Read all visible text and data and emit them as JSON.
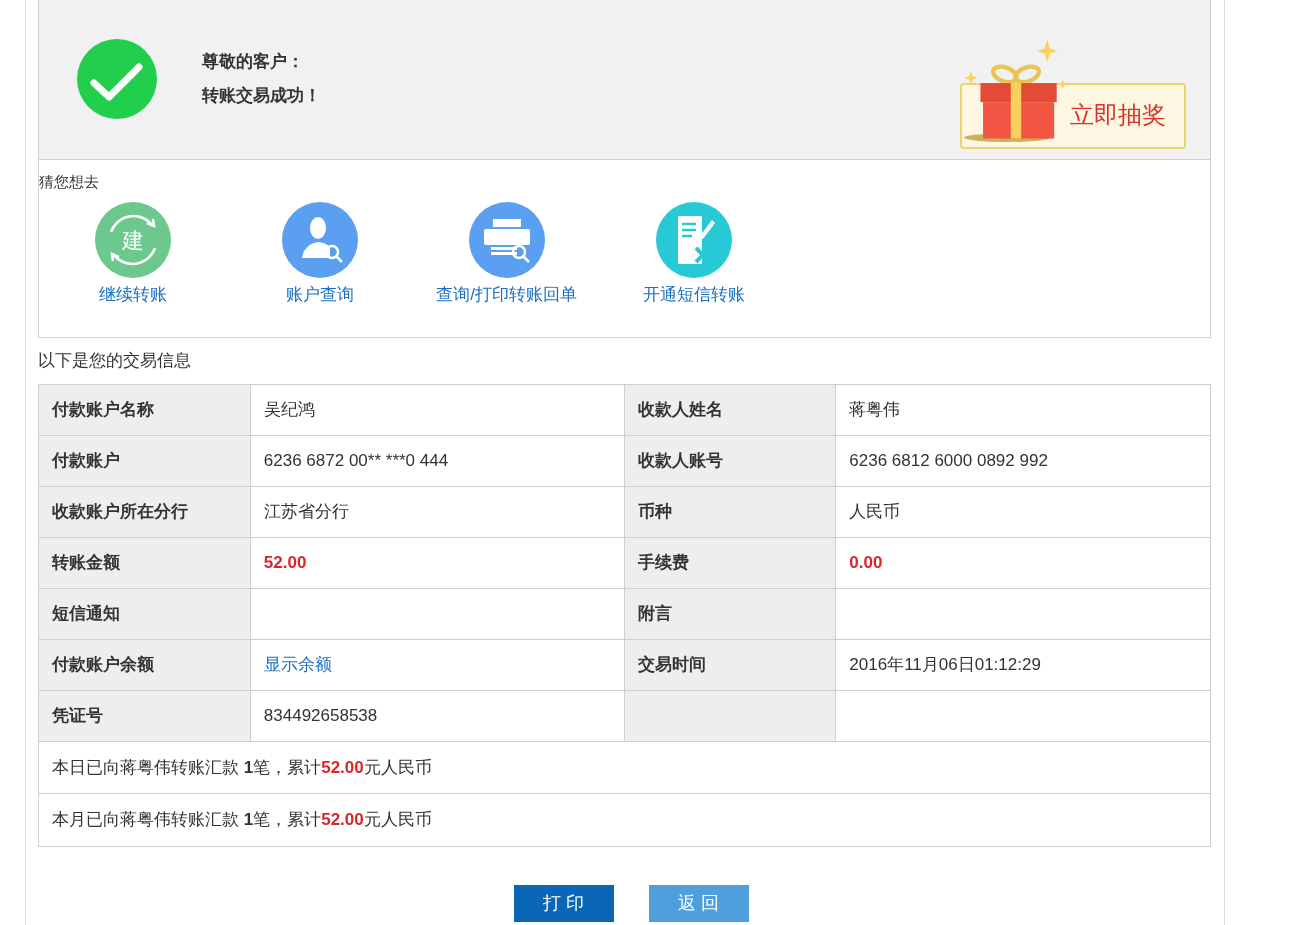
{
  "header": {
    "greeting": "尊敬的客户：",
    "message": "转账交易成功！",
    "lottery_button": "立即抽奖"
  },
  "quick_links": {
    "title": "猜您想去",
    "items": [
      {
        "kind": "transfer",
        "label": "继续转账",
        "icon_text": "建"
      },
      {
        "kind": "account",
        "label": "账户查询"
      },
      {
        "kind": "print",
        "label": "查询/打印转账回单"
      },
      {
        "kind": "sms",
        "label": "开通短信转账"
      }
    ]
  },
  "details": {
    "title": "以下是您的交易信息",
    "rows": [
      {
        "cells": [
          {
            "label": "付款账户名称",
            "value": "吴纪鸿",
            "kind": "plain"
          },
          {
            "label": "收款人姓名",
            "value": "蒋粤伟",
            "kind": "plain"
          }
        ]
      },
      {
        "cells": [
          {
            "label": "付款账户",
            "value": "6236 6872 00** ***0 444",
            "kind": "plain"
          },
          {
            "label": "收款人账号",
            "value": "6236 6812 6000 0892 992",
            "kind": "plain"
          }
        ]
      },
      {
        "cells": [
          {
            "label": "收款账户所在分行",
            "value": "江苏省分行",
            "kind": "plain"
          },
          {
            "label": "币种",
            "value": "人民币",
            "kind": "plain"
          }
        ]
      },
      {
        "cells": [
          {
            "label": "转账金额",
            "value": "52.00",
            "kind": "amount"
          },
          {
            "label": "手续费",
            "value": "0.00",
            "kind": "amount"
          }
        ]
      },
      {
        "cells": [
          {
            "label": "短信通知"
          },
          {
            "label": "附言"
          }
        ]
      },
      {
        "cells": [
          {
            "label": "付款账户余额",
            "value": "显示余额",
            "kind": "link"
          },
          {
            "label": "交易时间",
            "value": "2016年11月06日01:12:29",
            "kind": "plain"
          }
        ]
      },
      {
        "cells": [
          {
            "label": "凭证号",
            "value": "834492658538",
            "kind": "plain"
          },
          {}
        ]
      }
    ],
    "summaries": [
      {
        "before": "本日已向蒋粤伟转账汇款 ",
        "count": "1",
        "middle": "笔，累计",
        "amount": "52.00",
        "after": "元人民币"
      },
      {
        "before": "本月已向蒋粤伟转账汇款 ",
        "count": "1",
        "middle": "笔，累计",
        "amount": "52.00",
        "after": "元人民币"
      }
    ]
  },
  "buttons": [
    {
      "kind": "primary",
      "label": "打 印"
    },
    {
      "kind": "secondary",
      "label": "返 回"
    }
  ]
}
